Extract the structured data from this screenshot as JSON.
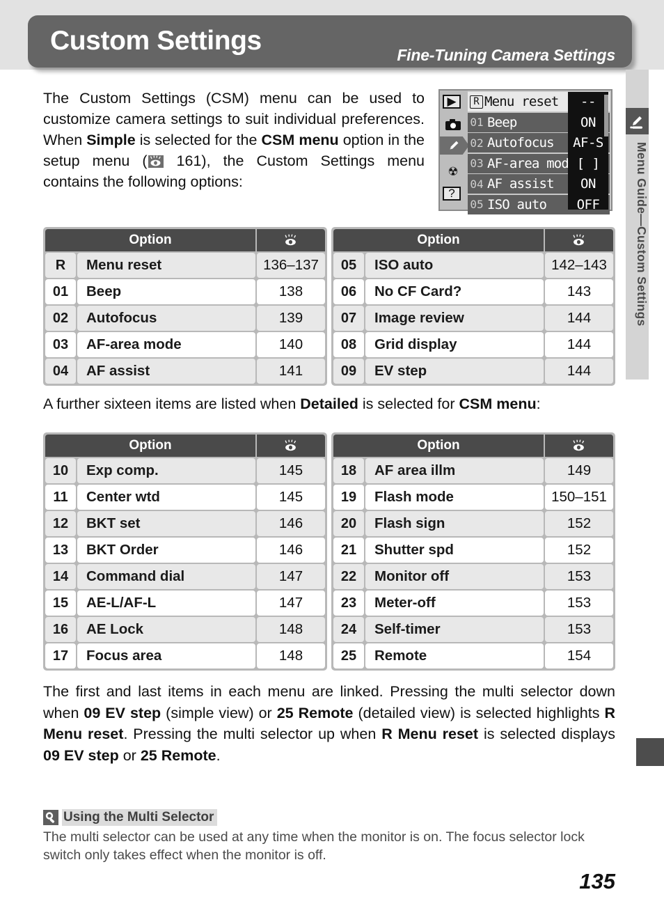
{
  "header": {
    "title": "Custom Settings",
    "subtitle": "Fine-Tuning Camera Settings"
  },
  "side_rail": {
    "label": "Menu Guide—Custom Settings",
    "icon": "pencil-icon"
  },
  "intro": {
    "part1": "The Custom Settings (CSM) menu can be used to customize camera settings to suit individual preferences.  When ",
    "bold1": "Simple",
    "part2": " is selected for the ",
    "bold2": "CSM menu",
    "part3": " option in the setup menu (",
    "ref_page": " 161),",
    "part4": " the Custom Settings menu contains the following options:"
  },
  "lcd": {
    "side_icons": [
      "play-icon",
      "camera-icon",
      "pencil-icon",
      "wrench-icon",
      "question-icon"
    ],
    "rows": [
      {
        "num": "R",
        "name": "Menu reset",
        "value": "--",
        "highlight": true
      },
      {
        "num": "01",
        "name": "Beep",
        "value": "ON",
        "highlight": false
      },
      {
        "num": "02",
        "name": "Autofocus",
        "value": "AF-S",
        "highlight": false
      },
      {
        "num": "03",
        "name": "AF-area mode",
        "value": "[ ]",
        "highlight": false
      },
      {
        "num": "04",
        "name": "AF assist",
        "value": "ON",
        "highlight": false
      },
      {
        "num": "05",
        "name": "ISO auto",
        "value": "OFF",
        "highlight": false
      }
    ]
  },
  "tables": {
    "column_headers": {
      "option": "Option",
      "page": "eye-icon"
    },
    "simple_left": [
      {
        "num": "R",
        "name": "Menu reset",
        "page": "136–137"
      },
      {
        "num": "01",
        "name": "Beep",
        "page": "138"
      },
      {
        "num": "02",
        "name": "Autofocus",
        "page": "139"
      },
      {
        "num": "03",
        "name": "AF-area mode",
        "page": "140"
      },
      {
        "num": "04",
        "name": "AF assist",
        "page": "141"
      }
    ],
    "simple_right": [
      {
        "num": "05",
        "name": "ISO auto",
        "page": "142–143"
      },
      {
        "num": "06",
        "name": "No CF Card?",
        "page": "143"
      },
      {
        "num": "07",
        "name": "Image review",
        "page": "144"
      },
      {
        "num": "08",
        "name": "Grid display",
        "page": "144"
      },
      {
        "num": "09",
        "name": "EV step",
        "page": "144"
      }
    ],
    "detailed_left": [
      {
        "num": "10",
        "name": "Exp comp.",
        "page": "145"
      },
      {
        "num": "11",
        "name": "Center wtd",
        "page": "145"
      },
      {
        "num": "12",
        "name": "BKT set",
        "page": "146"
      },
      {
        "num": "13",
        "name": "BKT Order",
        "page": "146"
      },
      {
        "num": "14",
        "name": "Command dial",
        "page": "147"
      },
      {
        "num": "15",
        "name": "AE-L/AF-L",
        "page": "147"
      },
      {
        "num": "16",
        "name": "AE Lock",
        "page": "148"
      },
      {
        "num": "17",
        "name": "Focus area",
        "page": "148"
      }
    ],
    "detailed_right": [
      {
        "num": "18",
        "name": "AF area illm",
        "page": "149"
      },
      {
        "num": "19",
        "name": "Flash mode",
        "page": "150–151"
      },
      {
        "num": "20",
        "name": "Flash sign",
        "page": "152"
      },
      {
        "num": "21",
        "name": "Shutter spd",
        "page": "152"
      },
      {
        "num": "22",
        "name": "Monitor off",
        "page": "153"
      },
      {
        "num": "23",
        "name": "Meter-off",
        "page": "153"
      },
      {
        "num": "24",
        "name": "Self-timer",
        "page": "153"
      },
      {
        "num": "25",
        "name": "Remote",
        "page": "154"
      }
    ]
  },
  "para_mid": {
    "part1": "A further sixteen items are listed when ",
    "bold1": "Detailed",
    "part2": " is selected for ",
    "bold2": "CSM menu",
    "part3": ":"
  },
  "para_bottom": {
    "part1": "The first and last items in each menu are linked.  Pressing the multi selector down when ",
    "bold1": "09 EV step",
    "part2": " (simple view) or ",
    "bold2": "25 Remote",
    "part3": " (detailed view) is selected highlights ",
    "bold3": "R Menu reset",
    "part4": ".  Pressing the multi selector up when ",
    "bold4": "R Menu reset",
    "part5": " is selected displays ",
    "bold5": "09 EV step",
    "part6": " or ",
    "bold6": "25 Remote",
    "part7": "."
  },
  "note": {
    "icon": "magnifier-icon",
    "title": "Using the Multi Selector",
    "body": "The multi selector can be used at any time when the monitor is on.  The focus selector lock switch only takes effect when the monitor is off."
  },
  "page_number": "135",
  "colors": {
    "header_plate": "#656565",
    "table_header": "#4a4a4a",
    "row_shaded": "#e8e8e8",
    "row_white": "#ffffff",
    "band": "#e2e2e2"
  }
}
